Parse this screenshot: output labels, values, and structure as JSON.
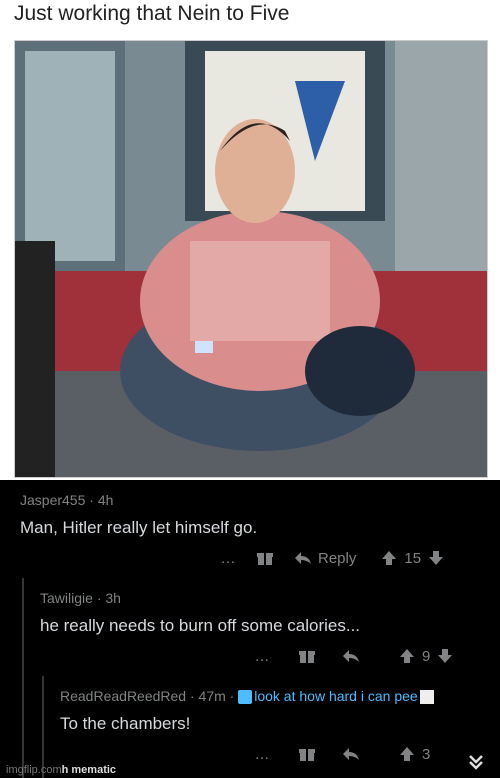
{
  "meme": {
    "title": "Just working that Nein to Five"
  },
  "comments": [
    {
      "username": "Jasper455",
      "time": "4h",
      "body": "Man, Hitler really let himself go.",
      "more": "…",
      "reply_label": "Reply",
      "votes": "15"
    },
    {
      "username": "Tawiligie",
      "time": "3h",
      "body": "he really needs to burn off some calories...",
      "more": "…",
      "votes": "9"
    },
    {
      "username": "ReadReadReedRed",
      "time": "47m",
      "flair": "look at how hard i can pee",
      "body": "To the chambers!",
      "more": "…",
      "votes": "3"
    }
  ],
  "watermark": {
    "site": "imgflip.com",
    "suffix": "h mematic"
  },
  "colors": {
    "background": "#000000",
    "text": "#d7dadc",
    "meta": "#818384",
    "flair": "#4fbcff"
  }
}
